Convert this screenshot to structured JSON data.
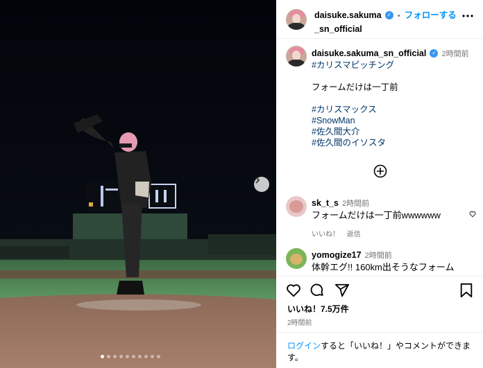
{
  "post": {
    "username_line1": "daisuke.sakuma",
    "username_line2": "_sn_official",
    "follow_label": "フォローする",
    "dot_separator": "•"
  },
  "caption": {
    "username": "daisuke.sakuma_sn_official",
    "time": "2時間前",
    "hashtag_top": "#カリスマピッチング",
    "text": "フォームだけは一丁前",
    "hashtags": [
      "#カリスマックス",
      "#SnowMan",
      "#佐久間大介",
      "#佐久間のイソスタ"
    ]
  },
  "comments": [
    {
      "username": "sk_t_s",
      "time": "2時間前",
      "text": "フォームだけは一丁前wwwwww",
      "like_label": "いいね！",
      "reply_label": "返信"
    },
    {
      "username": "yomogize17",
      "time": "2時間前",
      "text": "体幹エグ!! 160km出そうなフォーム"
    }
  ],
  "actions": {
    "likes": "いいね！7.5万件",
    "posted": "2時間前",
    "icons": [
      "heart-icon",
      "comment-icon",
      "share-icon",
      "bookmark-icon"
    ]
  },
  "login_prompt": {
    "link": "ログイン",
    "text": "すると「いいね！」やコメントができます。"
  },
  "carousel": {
    "total": 10,
    "active": 0
  },
  "colors": {
    "link": "#0095f6",
    "hashtag": "#00376b",
    "verified": "#3897f0",
    "muted": "#737373"
  }
}
